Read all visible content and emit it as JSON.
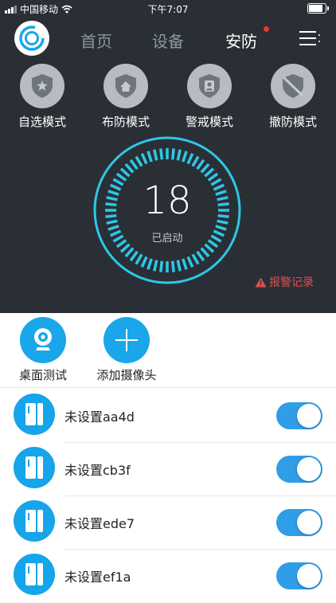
{
  "status_bar": {
    "carrier": "中国移动",
    "time": "下午7:07"
  },
  "nav": {
    "tabs": [
      {
        "label": "首页",
        "active": false
      },
      {
        "label": "设备",
        "active": false
      },
      {
        "label": "安防",
        "active": true,
        "badge": "red-dot"
      }
    ],
    "menu_icon": "menu-icon"
  },
  "modes": [
    {
      "label": "自选模式",
      "icon": "star-shield-icon"
    },
    {
      "label": "布防模式",
      "icon": "home-shield-icon"
    },
    {
      "label": "警戒模式",
      "icon": "person-shield-icon"
    },
    {
      "label": "撤防模式",
      "icon": "disarm-shield-icon"
    }
  ],
  "gauge": {
    "count": "18",
    "label": "已启动"
  },
  "alarm_record": {
    "label": "报警记录",
    "icon": "warning-icon"
  },
  "actions": [
    {
      "label": "桌面测试",
      "icon": "camera-icon"
    },
    {
      "label": "添加摄像头",
      "icon": "plus-icon"
    }
  ],
  "devices": [
    {
      "name": "未设置aa4d",
      "enabled": true
    },
    {
      "name": "未设置cb3f",
      "enabled": true
    },
    {
      "name": "未设置ede7",
      "enabled": true
    },
    {
      "name": "未设置ef1a",
      "enabled": true
    }
  ],
  "colors": {
    "header_bg": "#2a2f36",
    "accent": "#1aa6ea",
    "gauge": "#2ec8e6",
    "alarm": "#e05050",
    "toggle_on": "#2f9ee6"
  }
}
